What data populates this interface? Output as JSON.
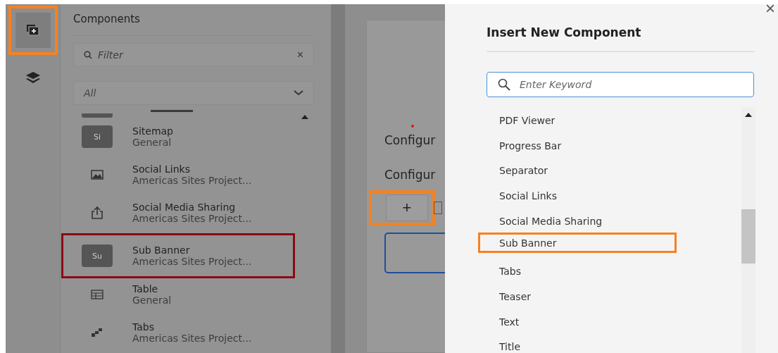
{
  "rail": [
    {
      "selected": true,
      "highlighted": true
    },
    {
      "selected": false,
      "highlighted": false
    }
  ],
  "components_panel": {
    "title": "Components",
    "filter": {
      "placeholder": "Filter",
      "clear": "×"
    },
    "group_select": {
      "value": "All"
    },
    "items": [
      {
        "kind": "badge",
        "badge": "Si",
        "name": "Sitemap",
        "group": "General",
        "highlighted": false
      },
      {
        "kind": "image",
        "name": "Social Links",
        "group": "Americas Sites Project...",
        "highlighted": false
      },
      {
        "kind": "share",
        "name": "Social Media Sharing",
        "group": "Americas Sites Project...",
        "highlighted": false
      },
      {
        "kind": "badge",
        "badge": "Su",
        "name": "Sub Banner",
        "group": "Americas Sites Project...",
        "highlighted": true
      },
      {
        "kind": "table",
        "name": "Table",
        "group": "General",
        "highlighted": false
      },
      {
        "kind": "tabs",
        "name": "Tabs",
        "group": "Americas Sites Project...",
        "highlighted": false
      }
    ]
  },
  "editor": {
    "headings": [
      "Configur",
      "Configur"
    ],
    "add_button": {
      "label": "+",
      "highlighted": true
    }
  },
  "dialog": {
    "close": "×",
    "title": "Insert New Component",
    "search": {
      "placeholder": "Enter Keyword"
    },
    "items": [
      {
        "label": "PDF Viewer",
        "highlighted": false
      },
      {
        "label": "Progress Bar",
        "highlighted": false
      },
      {
        "label": "Separator",
        "highlighted": false
      },
      {
        "label": "Social Links",
        "highlighted": false
      },
      {
        "label": "Social Media Sharing",
        "highlighted": false
      },
      {
        "label": "Sub Banner",
        "highlighted": true
      },
      {
        "label": "Tabs",
        "highlighted": false
      },
      {
        "label": "Teaser",
        "highlighted": false
      },
      {
        "label": "Text",
        "highlighted": false
      },
      {
        "label": "Title",
        "highlighted": false
      }
    ]
  }
}
